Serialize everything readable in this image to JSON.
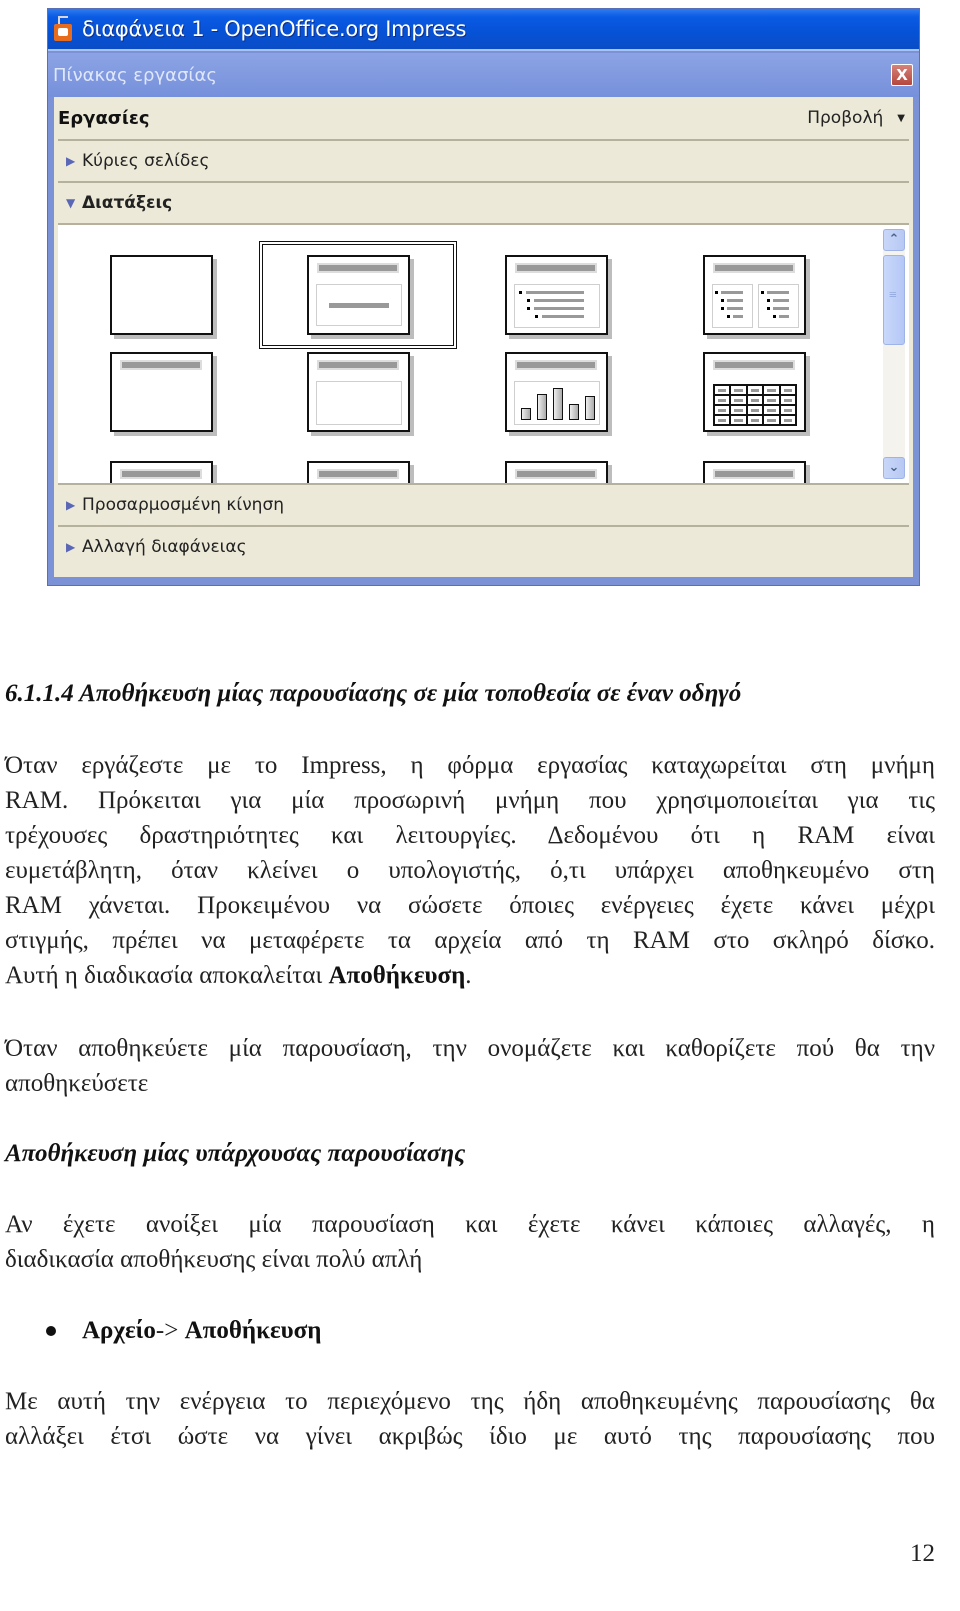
{
  "window": {
    "title": "διαφάνεια 1 - OpenOffice.org Impress",
    "panel_title": "Πίνακας εργασίας",
    "close_label": "X",
    "tasks_label": "Εργασίες",
    "view_menu_label": "Προβολή",
    "view_menu_caret": "▼",
    "sections": {
      "master_pages": {
        "label": "Κύριες σελίδες",
        "expanded": false,
        "icon": "▶"
      },
      "layouts": {
        "label": "Διατάξεις",
        "expanded": true,
        "icon": "▼"
      },
      "custom_animation": {
        "label": "Προσαρμοσμένη κίνηση",
        "expanded": false,
        "icon": "▶"
      },
      "slide_transition": {
        "label": "Αλλαγή διαφάνειας",
        "expanded": false,
        "icon": "▶"
      }
    },
    "layout_items": [
      {
        "name": "blank",
        "selected": false
      },
      {
        "name": "title-slide",
        "selected": true
      },
      {
        "name": "title-content",
        "selected": false
      },
      {
        "name": "title-2-content",
        "selected": false
      },
      {
        "name": "title-only",
        "selected": false
      },
      {
        "name": "centered-text",
        "selected": false
      },
      {
        "name": "title-chart",
        "selected": false
      },
      {
        "name": "title-table",
        "selected": false
      },
      {
        "name": "layout-9",
        "selected": false
      },
      {
        "name": "layout-10",
        "selected": false
      },
      {
        "name": "layout-11",
        "selected": false
      },
      {
        "name": "layout-12",
        "selected": false
      }
    ],
    "scrollbar": {
      "up_icon": "⌃",
      "down_icon": "⌄",
      "position": 0
    }
  },
  "document": {
    "heading": "6.1.1.4  Αποθήκευση μίας παρουσίασης σε μία τοποθεσία σε έναν οδηγό",
    "para1_lines": [
      "Όταν εργάζεστε με το Impress, η φόρμα εργασίας καταχωρείται στη μνήμη",
      "RAM.  Πρόκειται για μία προσωρινή μνήμη που χρησιμοποιείται για τις",
      "τρέχουσες δραστηριότητες και λειτουργίες.  Δεδομένου ότι η RAM είναι",
      "ευμετάβλητη, όταν κλείνει ο υπολογιστής, ό,τι υπάρχει αποθηκευμένο στη",
      "RAM χάνεται.  Προκειμένου να σώσετε όποιες ενέργειες έχετε κάνει μέχρι",
      "στιγμής, πρέπει να μεταφέρετε τα αρχεία από τη RAM στο σκληρό δίσκο."
    ],
    "para1_last_prefix": "Αυτή η διαδικασία αποκαλείται ",
    "para1_last_bold": "Αποθήκευση",
    "para1_last_suffix": ".",
    "para2_lines": [
      "Όταν αποθηκεύετε μία παρουσίαση, την ονομάζετε και καθορίζετε πού θα την",
      "αποθηκεύσετε"
    ],
    "subheading": "Αποθήκευση μίας υπάρχουσας παρουσίασης",
    "para3_lines": [
      "Αν έχετε ανοίξει μία παρουσίαση και έχετε κάνει κάποιες αλλαγές, η",
      "διαδικασία αποθήκευσης είναι πολύ απλή"
    ],
    "bullet": {
      "part1": "Αρχείο",
      "arrow": "-> ",
      "part2": "Αποθήκευση"
    },
    "para4_lines": [
      "Με αυτή την ενέργεια το περιεχόμενο της ήδη αποθηκευμένης παρουσίασης θα",
      "αλλάξει έτσι ώστε να γίνει ακριβώς ίδιο με αυτό της παρουσίασης που"
    ],
    "page_number": "12"
  }
}
